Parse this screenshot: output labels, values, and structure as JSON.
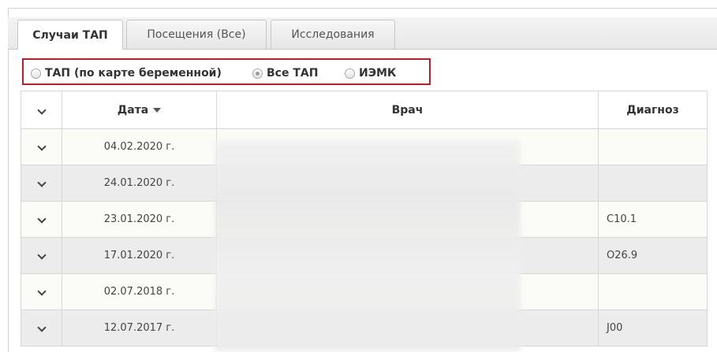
{
  "tabs": [
    {
      "label": "Случаи ТАП",
      "active": true
    },
    {
      "label": "Посещения (Все)",
      "active": false
    },
    {
      "label": "Исследования",
      "active": false
    }
  ],
  "filter": {
    "options": [
      {
        "label": "ТАП (по карте беременной)",
        "checked": false
      },
      {
        "label": "Все ТАП",
        "checked": true
      },
      {
        "label": "ИЭМК",
        "checked": false
      }
    ]
  },
  "table": {
    "headers": {
      "expand": "",
      "date": "Дата",
      "doctor": "Врач",
      "diagnosis": "Диагноз"
    },
    "rows": [
      {
        "date": "04.02.2020 г.",
        "doctor": "",
        "diagnosis": ""
      },
      {
        "date": "24.01.2020 г.",
        "doctor": "",
        "diagnosis": ""
      },
      {
        "date": "23.01.2020 г.",
        "doctor": "",
        "diagnosis": "C10.1"
      },
      {
        "date": "17.01.2020 г.",
        "doctor": "",
        "diagnosis": "O26.9"
      },
      {
        "date": "02.07.2018 г.",
        "doctor": "",
        "diagnosis": ""
      },
      {
        "date": "12.07.2017 г.",
        "doctor": "",
        "diagnosis": "J00"
      }
    ]
  },
  "colors": {
    "highlight_border": "#b7202a"
  }
}
